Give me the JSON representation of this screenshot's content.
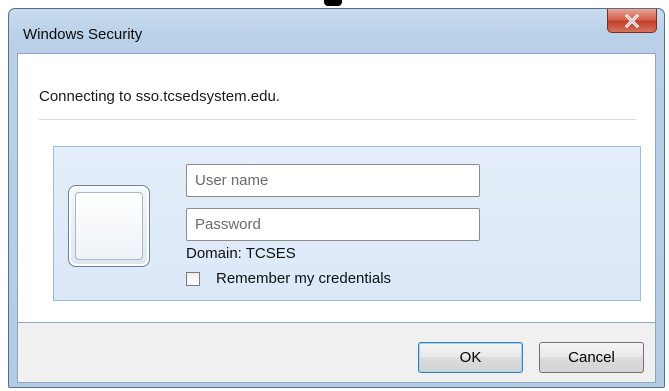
{
  "window": {
    "title": "Windows Security"
  },
  "message": {
    "connecting": "Connecting to sso.tcsedsystem.edu."
  },
  "credentials": {
    "username_placeholder": "User name",
    "password_placeholder": "Password",
    "domain": "Domain: TCSES",
    "remember_label": "Remember my credentials",
    "remember_checked": false
  },
  "buttons": {
    "ok": "OK",
    "cancel": "Cancel"
  },
  "icons": {
    "close": "close-x-icon",
    "user_tile": "user-account-tile-icon"
  }
}
